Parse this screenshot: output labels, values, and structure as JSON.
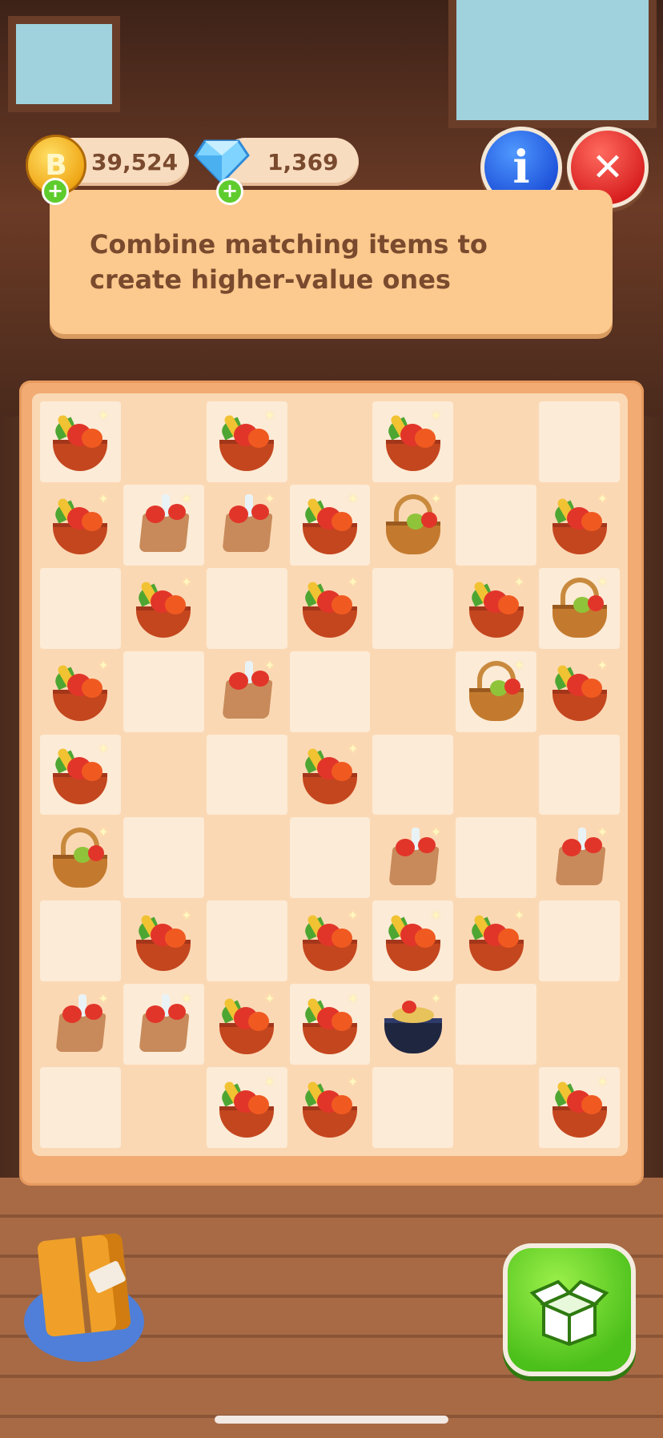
{
  "currency": {
    "coins": "39,524",
    "coin_symbol": "B",
    "gems": "1,369"
  },
  "buttons": {
    "info_label": "i",
    "close_label": "✕",
    "plus_label": "+"
  },
  "banner": {
    "text": "Combine matching items to create higher-value ones"
  },
  "board": {
    "columns": 7,
    "rows": 9,
    "cells": [
      [
        "bowl",
        "",
        "bowl",
        "",
        "bowl",
        "",
        ""
      ],
      [
        "bowl",
        "bag",
        "bag",
        "bowl",
        "basket",
        "",
        "bowl"
      ],
      [
        "",
        "bowl",
        "",
        "bowl",
        "",
        "bowl",
        "basket"
      ],
      [
        "bowl",
        "",
        "bag",
        "",
        "",
        "basket",
        "bowl"
      ],
      [
        "bowl",
        "",
        "",
        "bowl",
        "",
        "",
        ""
      ],
      [
        "basket",
        "",
        "",
        "",
        "bag",
        "",
        "bag"
      ],
      [
        "",
        "bowl",
        "",
        "bowl",
        "bowl",
        "bowl",
        ""
      ],
      [
        "bag",
        "bag",
        "bowl",
        "bowl",
        "pot",
        "",
        ""
      ],
      [
        "",
        "",
        "bowl",
        "bowl",
        "",
        "",
        "bowl"
      ]
    ]
  },
  "colors": {
    "board_frame": "#f1ab73",
    "cell_light": "#fcebd6",
    "cell_dark": "#fbd8b4",
    "banner": "#fcc98e",
    "text": "#7a4a2e",
    "info_button": "#1c4fd8",
    "close_button": "#d71e1e",
    "box_button": "#4bbf1a"
  },
  "icons": {
    "coin": "coin-icon",
    "gem": "gem-icon",
    "info": "info-icon",
    "close": "close-icon",
    "gift": "gift-box-icon",
    "storage": "open-box-icon"
  }
}
